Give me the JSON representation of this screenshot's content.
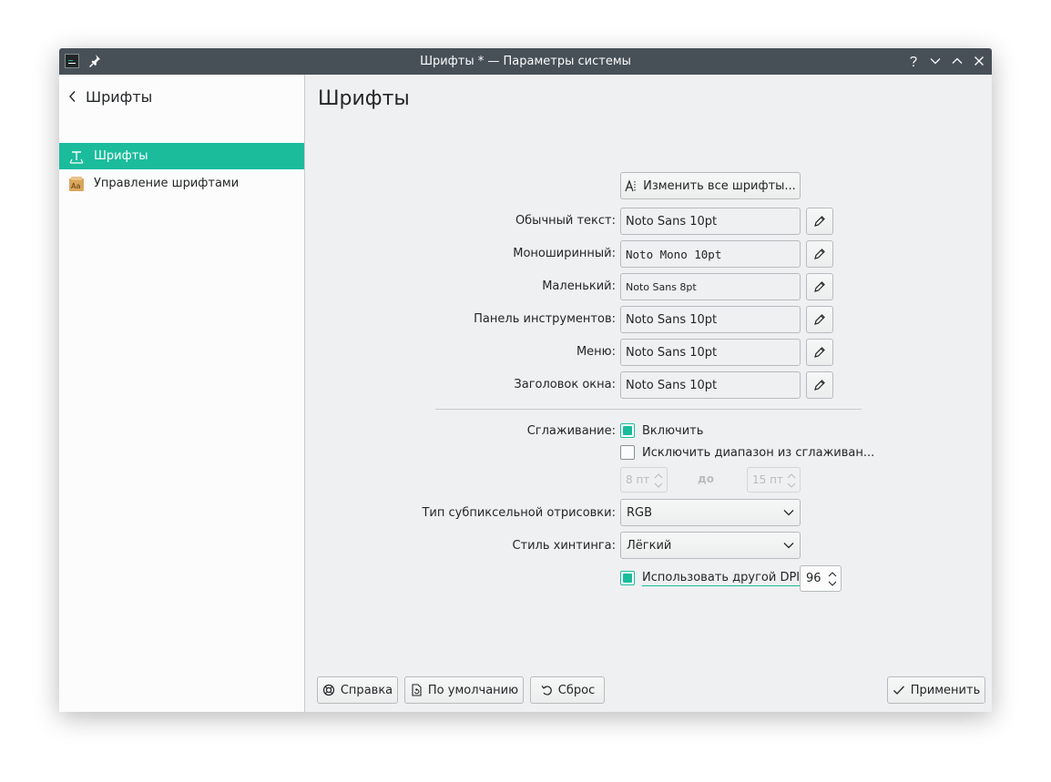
{
  "window": {
    "title": "Шрифты * — Параметры системы"
  },
  "sidebar": {
    "header": "Шрифты",
    "items": [
      {
        "label": "Шрифты",
        "icon": "fonts-icon",
        "active": true
      },
      {
        "label": "Управление шрифтами",
        "icon": "font-manager-icon",
        "active": false
      }
    ]
  },
  "main": {
    "title": "Шрифты",
    "change_all_label": "Изменить все шрифты...",
    "fonts": [
      {
        "label": "Обычный текст:",
        "value": "Noto Sans 10pt"
      },
      {
        "label": "Моноширинный:",
        "value": "Noto Mono 10pt"
      },
      {
        "label": "Маленький:",
        "value": "Noto Sans 8pt"
      },
      {
        "label": "Панель инструментов:",
        "value": "Noto Sans 10pt"
      },
      {
        "label": "Меню:",
        "value": "Noto Sans 10pt"
      },
      {
        "label": "Заголовок окна:",
        "value": "Noto Sans 10pt"
      }
    ],
    "antialiasing": {
      "label": "Сглаживание:",
      "enable_label": "Включить",
      "enable_checked": true,
      "exclude_label": "Исключить диапазон из сглаживан...",
      "exclude_checked": false,
      "range_from": "8 пт",
      "range_to_label": "до",
      "range_to": "15 пт"
    },
    "subpixel": {
      "label": "Тип субпиксельной отрисовки:",
      "value": "RGB"
    },
    "hinting": {
      "label": "Стиль хинтинга:",
      "value": "Лёгкий"
    },
    "dpi": {
      "label": "Использовать другой DPI:",
      "checked": true,
      "value": "96"
    }
  },
  "footer": {
    "help": "Справка",
    "defaults": "По умолчанию",
    "reset": "Сброс",
    "apply": "Применить"
  },
  "colors": {
    "accent": "#1abc9c",
    "titlebar": "#475057",
    "window_bg": "#eff0f1",
    "sidebar_bg": "#fcfcfc"
  }
}
